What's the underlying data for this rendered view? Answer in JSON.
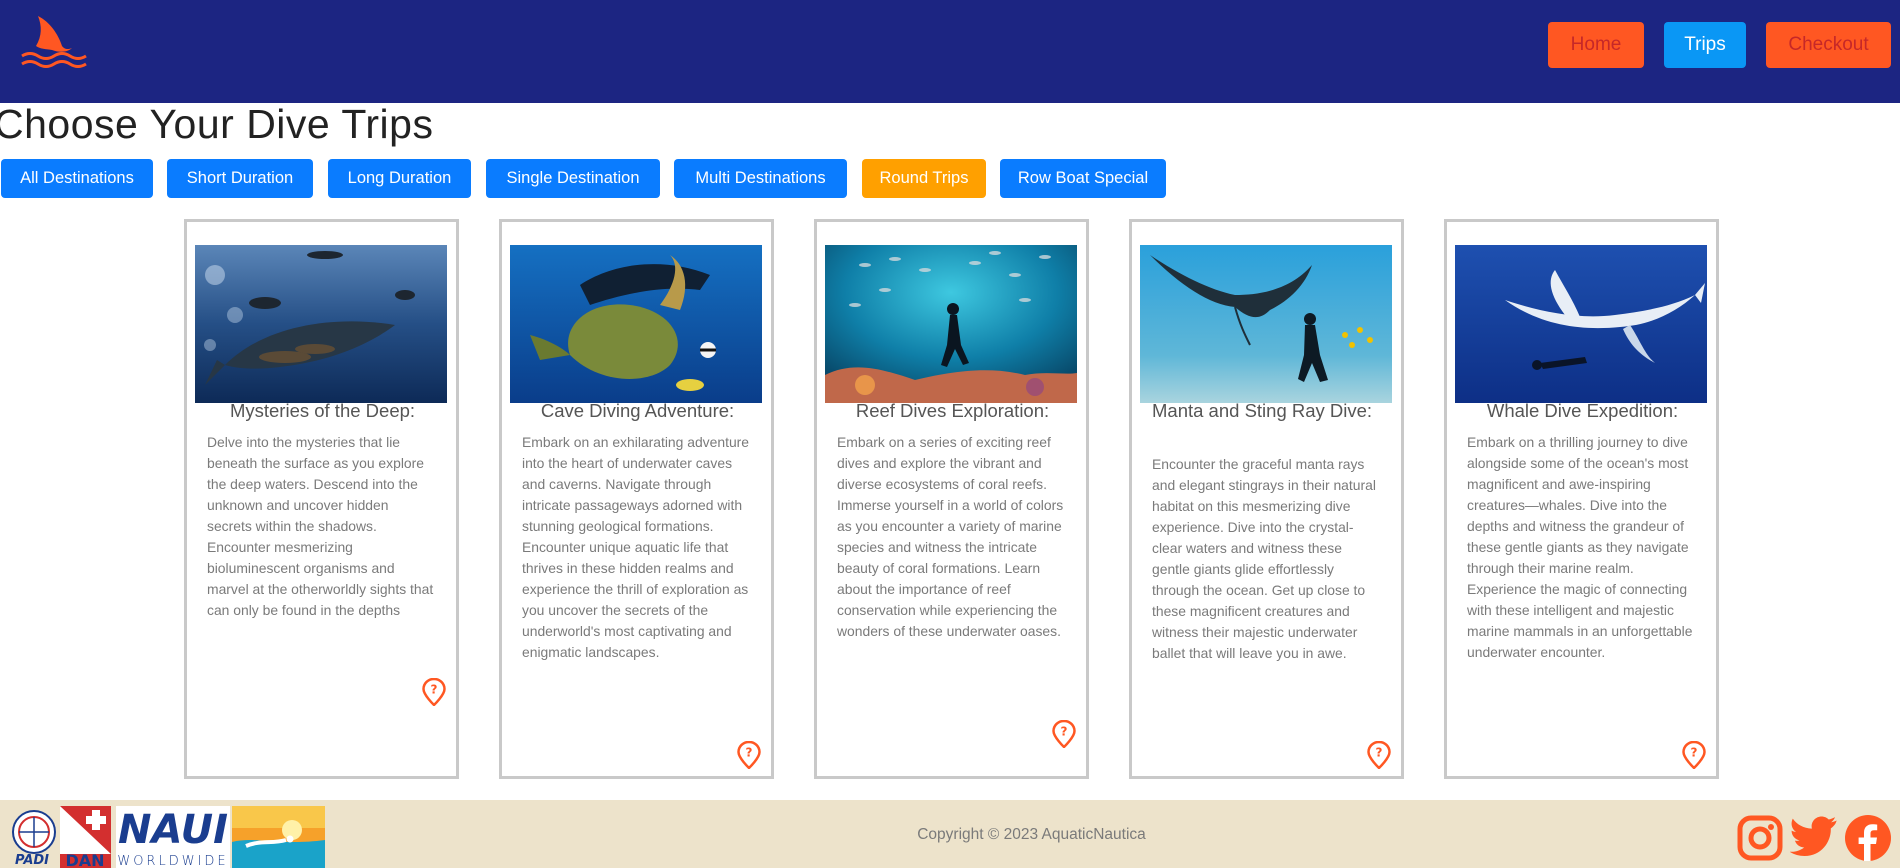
{
  "header": {
    "logo_icon": "shark-fin-icon",
    "nav": [
      {
        "label": "Home"
      },
      {
        "label": "Trips"
      },
      {
        "label": "Checkout"
      }
    ]
  },
  "page_title": "Choose Your Dive Trips",
  "filters": [
    {
      "label": "All Destinations",
      "active": false
    },
    {
      "label": "Short Duration",
      "active": false
    },
    {
      "label": "Long Duration",
      "active": false
    },
    {
      "label": "Single Destination",
      "active": false
    },
    {
      "label": "Multi Destinations",
      "active": false
    },
    {
      "label": "Round Trips",
      "active": true
    },
    {
      "label": "Row Boat Special",
      "active": false
    }
  ],
  "cards": [
    {
      "title": "Mysteries of the Deep:",
      "image": "whale-shark-photo",
      "description": "Delve into the mysteries that lie beneath the surface as you explore the deep waters. Descend into the unknown and uncover hidden secrets within the shadows. Encounter mesmerizing bioluminescent organisms and marvel at the otherworldly sights that can only be found in the depths",
      "icon": "help-location-icon"
    },
    {
      "title": "Cave Diving Adventure:",
      "image": "sea-turtle-photo",
      "description": "Embark on an exhilarating adventure into the heart of underwater caves and caverns. Navigate through intricate passageways adorned with stunning geological formations. Encounter unique aquatic life that thrives in these hidden realms and experience the thrill of exploration as you uncover the secrets of the underworld's most captivating and enigmatic landscapes.",
      "icon": "help-location-icon"
    },
    {
      "title": "Reef Dives Exploration:",
      "image": "reef-diver-photo",
      "description": "Embark on a series of exciting reef dives and explore the vibrant and diverse ecosystems of coral reefs. Immerse yourself in a world of colors as you encounter a variety of marine species and witness the intricate beauty of coral formations. Learn about the importance of reef conservation while experiencing the wonders of these underwater oases.",
      "icon": "help-location-icon"
    },
    {
      "title": "Manta and Sting Ray Dive:",
      "image": "manta-ray-photo",
      "description": "Encounter the graceful manta rays and elegant stingrays in their natural habitat on this mesmerizing dive experience. Dive into the crystal-clear waters and witness these gentle giants glide effortlessly through the ocean. Get up close to these magnificent creatures and witness their majestic underwater ballet that will leave you in awe.",
      "icon": "help-location-icon"
    },
    {
      "title": "Whale Dive Expedition:",
      "image": "humpback-whale-photo",
      "description": "Embark on a thrilling journey to dive alongside some of the ocean's most magnificent and awe-inspiring creatures—whales. Dive into the depths and witness the grandeur of these gentle giants as they navigate through their marine realm. Experience the magic of connecting with these intelligent and majestic marine mammals in an unforgettable underwater encounter.",
      "icon": "help-location-icon"
    }
  ],
  "footer": {
    "cert_logos": {
      "padi": "PADI",
      "dan": "DAN",
      "naui_1": "NAUI",
      "naui_2": "WORLDWIDE"
    },
    "copyright": "Copyright © 2023 AquaticNautica",
    "social": [
      {
        "icon": "instagram-icon"
      },
      {
        "icon": "twitter-icon"
      },
      {
        "icon": "facebook-icon"
      }
    ]
  },
  "colors": {
    "header_bg": "#1c2582",
    "accent_orange": "#ff5722",
    "primary_blue": "#0a7cff",
    "active_filter": "#ffa000",
    "footer_bg": "#ede3cb"
  }
}
